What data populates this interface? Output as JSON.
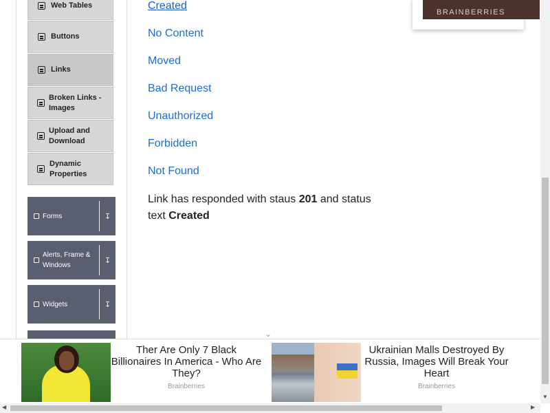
{
  "sidebar": {
    "elements_items": [
      {
        "label": "Web Tables"
      },
      {
        "label": "Buttons"
      },
      {
        "label": "Links"
      },
      {
        "label": "Broken Links - Images"
      },
      {
        "label": "Upload and Download"
      },
      {
        "label": "Dynamic Properties"
      }
    ],
    "groups": [
      {
        "label": "Forms"
      },
      {
        "label": "Alerts, Frame & Windows"
      },
      {
        "label": "Widgets"
      }
    ]
  },
  "main": {
    "links": [
      {
        "label": "Created"
      },
      {
        "label": "No Content"
      },
      {
        "label": "Moved"
      },
      {
        "label": "Bad Request"
      },
      {
        "label": "Unauthorized"
      },
      {
        "label": "Forbidden"
      },
      {
        "label": "Not Found"
      }
    ],
    "response": {
      "prefix": "Link has responded with staus",
      "status_code": "201",
      "middle": "and status text",
      "status_text": "Created"
    }
  },
  "top_ad": {
    "brand": "BRAINBERRIES"
  },
  "bottom_ads": [
    {
      "title": "Ther Are Only 7 Black Billionaires In America - Who Are They?",
      "source": "Brainberries"
    },
    {
      "title": "Ukrainian Malls Destroyed By Russia, Images Will Break Your Heart",
      "source": "Brainberries"
    }
  ]
}
